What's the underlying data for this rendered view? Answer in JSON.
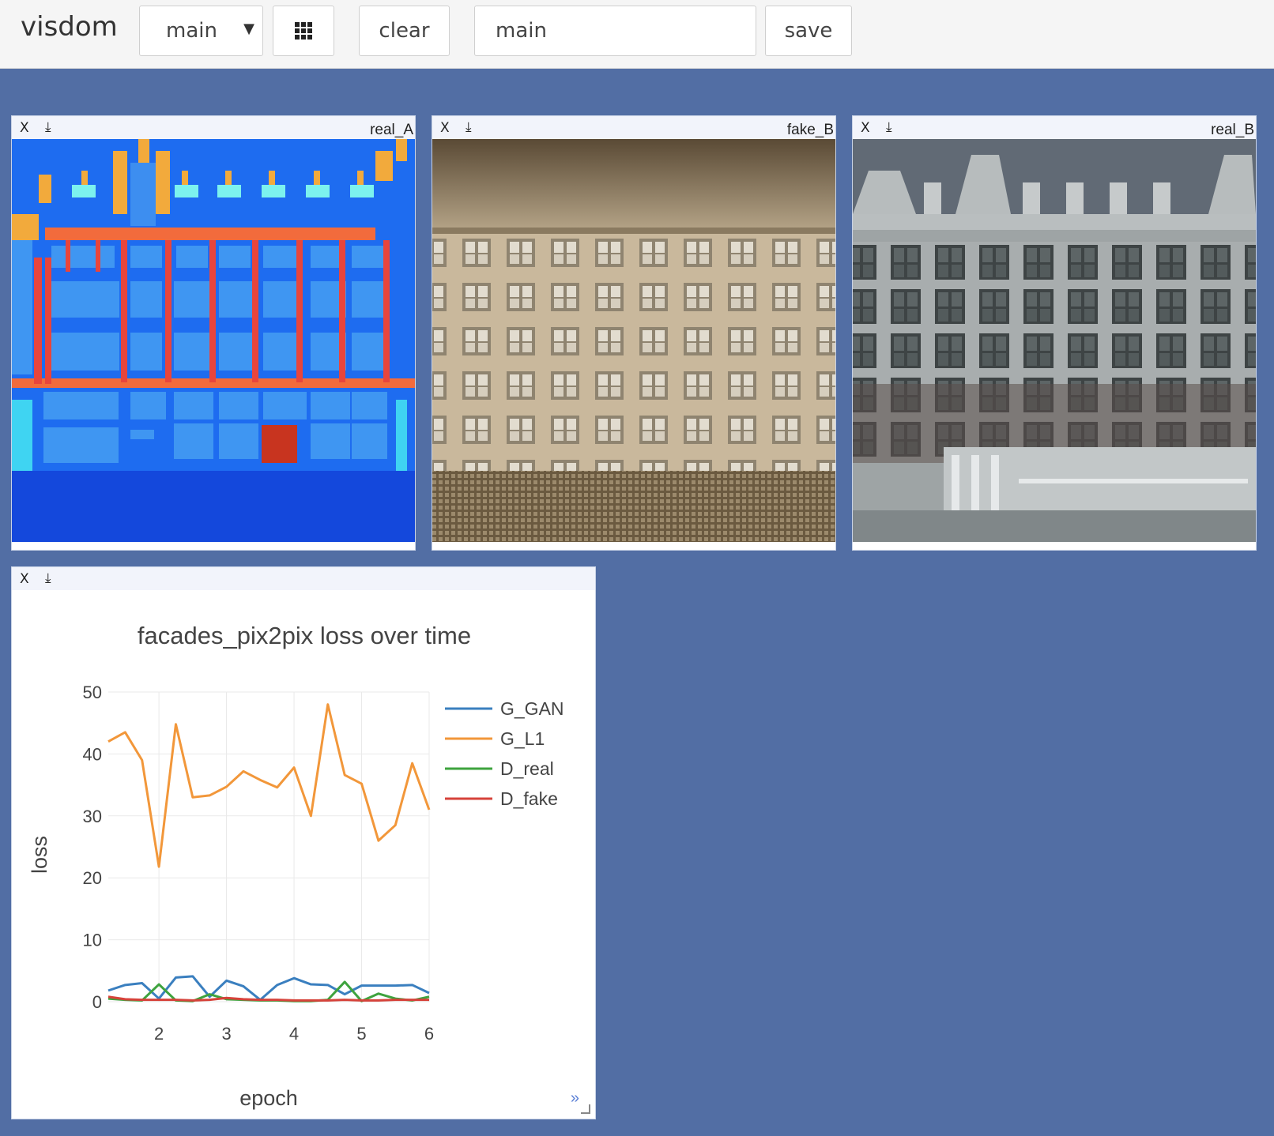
{
  "app": {
    "brand": "visdom"
  },
  "toolbar": {
    "env_select_value": "main",
    "clear_label": "clear",
    "env_input_value": "main",
    "save_label": "save"
  },
  "panes": [
    {
      "title": "real_A",
      "close": "X",
      "download": "⤓"
    },
    {
      "title": "fake_B",
      "close": "X",
      "download": "⤓"
    },
    {
      "title": "real_B",
      "close": "X",
      "download": "⤓"
    }
  ],
  "plot_pane": {
    "close": "X",
    "download": "⤓",
    "more": "»"
  },
  "chart_data": {
    "type": "line",
    "title": "facades_pix2pix loss over time",
    "xlabel": "epoch",
    "ylabel": "loss",
    "xlim": [
      1.25,
      6
    ],
    "ylim": [
      0,
      50
    ],
    "x_ticks": [
      2,
      3,
      4,
      5,
      6
    ],
    "y_ticks": [
      0,
      10,
      20,
      30,
      40,
      50
    ],
    "grid": true,
    "legend_position": "right",
    "x": [
      1.25,
      1.5,
      1.75,
      2.0,
      2.25,
      2.5,
      2.75,
      3.0,
      3.25,
      3.5,
      3.75,
      4.0,
      4.25,
      4.5,
      4.75,
      5.0,
      5.25,
      5.5,
      5.75,
      6.0
    ],
    "series": [
      {
        "name": "G_GAN",
        "color": "#3a7fbf",
        "values": [
          1.8,
          2.7,
          3.0,
          0.5,
          3.9,
          4.1,
          0.8,
          3.4,
          2.5,
          0.3,
          2.7,
          3.8,
          2.8,
          2.7,
          1.2,
          2.6,
          2.6,
          2.6,
          2.7,
          1.4
        ]
      },
      {
        "name": "G_L1",
        "color": "#f2973a",
        "values": [
          42.0,
          43.5,
          39.0,
          21.8,
          44.8,
          33.0,
          33.3,
          34.7,
          37.2,
          35.8,
          34.6,
          37.8,
          30.0,
          48.0,
          36.6,
          35.2,
          26.0,
          28.5,
          38.5,
          31.0
        ]
      },
      {
        "name": "D_real",
        "color": "#3ea33e",
        "values": [
          0.5,
          0.3,
          0.2,
          2.8,
          0.2,
          0.1,
          1.2,
          0.4,
          0.3,
          0.2,
          0.2,
          0.1,
          0.1,
          0.3,
          3.2,
          0.1,
          1.3,
          0.5,
          0.2,
          0.8
        ]
      },
      {
        "name": "D_fake",
        "color": "#d6423a",
        "values": [
          0.8,
          0.4,
          0.3,
          0.3,
          0.3,
          0.2,
          0.3,
          0.6,
          0.4,
          0.3,
          0.3,
          0.2,
          0.2,
          0.2,
          0.3,
          0.2,
          0.2,
          0.3,
          0.3,
          0.3
        ]
      }
    ]
  }
}
